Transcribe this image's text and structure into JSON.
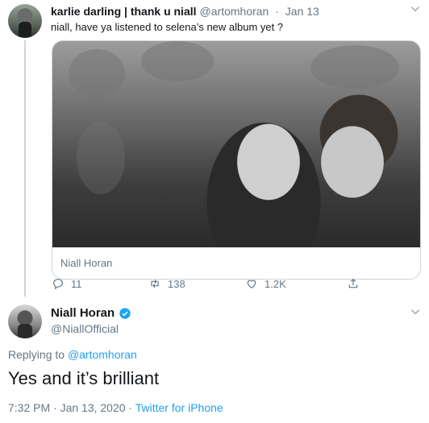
{
  "parent_tweet": {
    "display_name": "karlie darling | thank u niall",
    "handle": "@artomhoran",
    "separator": "·",
    "date": "Jan 13",
    "text": "niall, have ya listened to selena’s new album yet ?",
    "media_caption": "Niall Horan",
    "reply_count": "11",
    "retweet_count": "138",
    "like_count": "1.2K"
  },
  "main_tweet": {
    "display_name": "Niall Horan",
    "handle": "@NiallOfficial",
    "replying_prefix": "Replying to",
    "replying_to": "@artomhoran",
    "text": "Yes and it’s brilliant",
    "timestamp": "7:32 PM · Jan 13, 2020 ·",
    "source": "Twitter for iPhone"
  },
  "icons": {
    "caret": "chevron-down-icon",
    "reply": "reply-icon",
    "retweet": "retweet-icon",
    "like": "heart-icon",
    "share": "share-icon",
    "verified": "verified-badge-icon"
  },
  "colors": {
    "accent": "#1da1f2",
    "secondary_text": "#657786",
    "primary_text": "#14171a",
    "border": "#ccd6dd"
  }
}
